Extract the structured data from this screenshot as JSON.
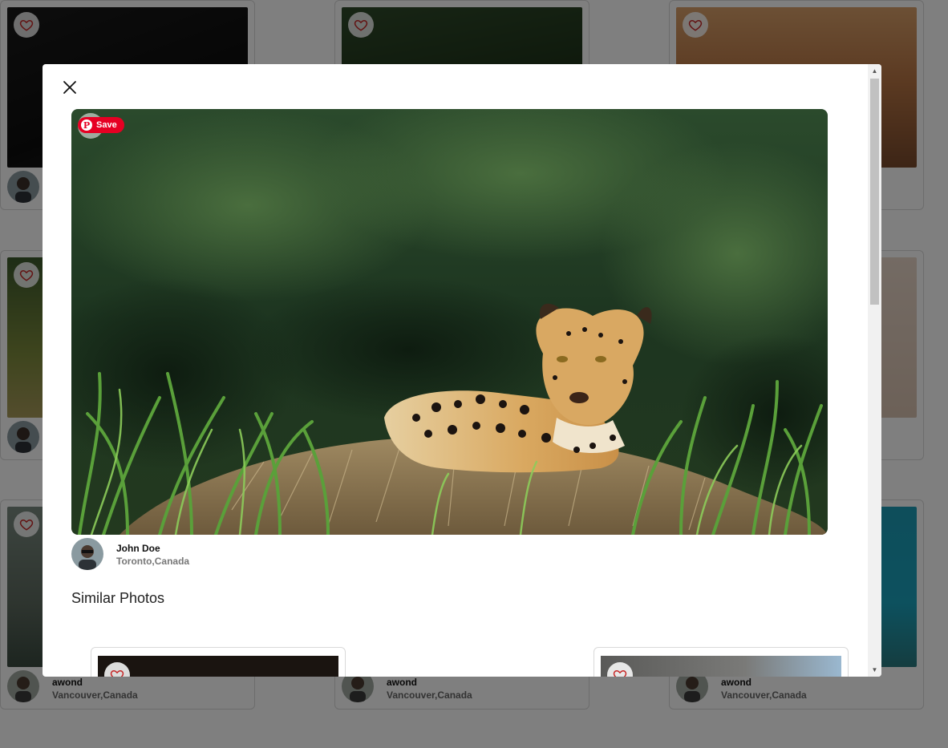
{
  "background_cards": [
    {
      "author": "",
      "location": ""
    },
    {
      "author": "",
      "location": ""
    },
    {
      "author": "",
      "location": ""
    },
    {
      "author": "",
      "location": ""
    },
    {
      "author": "",
      "location": ""
    },
    {
      "author": "awond",
      "location": "Vancouver,Canada"
    },
    {
      "author": "awond",
      "location": "Vancouver,Canada"
    },
    {
      "author": "awond",
      "location": "Vancouver,Canada"
    }
  ],
  "modal": {
    "save_label": "Save",
    "pin_glyph": "P",
    "author_name": "John Doe",
    "author_location": "Toronto,Canada",
    "similar_title": "Similar Photos"
  },
  "icons": {
    "close": "close-icon",
    "heart": "heart-outline-icon",
    "pinterest": "pinterest-logo-icon"
  },
  "colors": {
    "heart_stroke": "#c62828",
    "pinterest_red": "#e60023",
    "overlay": "rgba(0,0,0,0.5)"
  }
}
